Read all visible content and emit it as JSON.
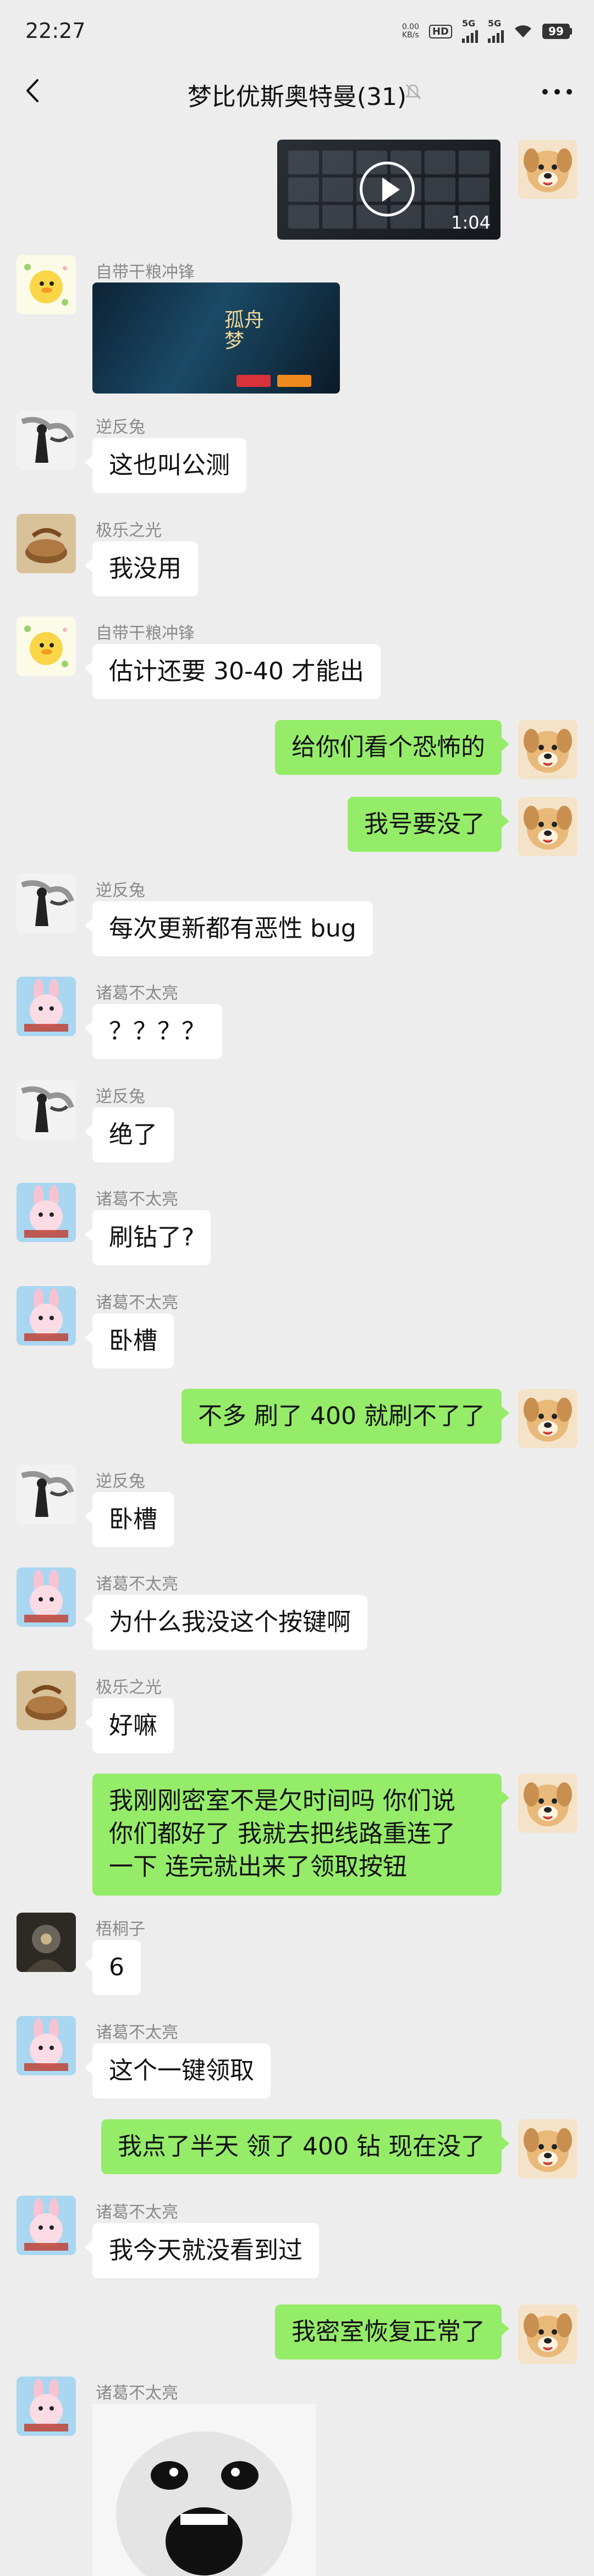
{
  "status": {
    "time": "22:27",
    "net_speed_value": "0.00",
    "net_speed_unit": "KB/s",
    "hd": "HD",
    "sim1": "5G",
    "sim2": "5G",
    "battery": "99"
  },
  "header": {
    "title": "梦比优斯奥特曼(31)"
  },
  "video": {
    "duration": "1:04"
  },
  "game_image": {
    "title": "孤舟\n梦"
  },
  "messages": [
    {
      "side": "left",
      "name": "自带干粮冲锋",
      "type": "image"
    },
    {
      "side": "left",
      "name": "逆反兔",
      "text": "这也叫公测"
    },
    {
      "side": "left",
      "name": "极乐之光",
      "text": "我没用"
    },
    {
      "side": "left",
      "name": "自带干粮冲锋",
      "text": "估计还要 30-40 才能出"
    },
    {
      "side": "right",
      "text": "给你们看个恐怖的"
    },
    {
      "side": "right",
      "text": "我号要没了"
    },
    {
      "side": "left",
      "name": "逆反兔",
      "text": "每次更新都有恶性 bug"
    },
    {
      "side": "left",
      "name": "诸葛不太亮",
      "text": "？？？？"
    },
    {
      "side": "left",
      "name": "逆反兔",
      "text": "绝了"
    },
    {
      "side": "left",
      "name": "诸葛不太亮",
      "text": "刷钻了?"
    },
    {
      "side": "left",
      "name": "诸葛不太亮",
      "text": "卧槽"
    },
    {
      "side": "right",
      "text": "不多 刷了 400 就刷不了了"
    },
    {
      "side": "left",
      "name": "逆反兔",
      "text": "卧槽"
    },
    {
      "side": "left",
      "name": "诸葛不太亮",
      "text": "为什么我没这个按键啊"
    },
    {
      "side": "left",
      "name": "极乐之光",
      "text": "好嘛"
    },
    {
      "side": "right",
      "text": "我刚刚密室不是欠时间吗 你们说\n你们都好了 我就去把线路重连了\n一下 连完就出来了领取按钮"
    },
    {
      "side": "left",
      "name": "梧桐子",
      "text": "6"
    },
    {
      "side": "left",
      "name": "诸葛不太亮",
      "text": "这个一键领取"
    },
    {
      "side": "right",
      "text": "我点了半天 领了 400 钻 现在没了"
    },
    {
      "side": "left",
      "name": "诸葛不太亮",
      "text": "我今天就没看到过"
    },
    {
      "side": "right",
      "text": "我密室恢复正常了"
    },
    {
      "side": "left",
      "name": "诸葛不太亮",
      "type": "image"
    }
  ]
}
